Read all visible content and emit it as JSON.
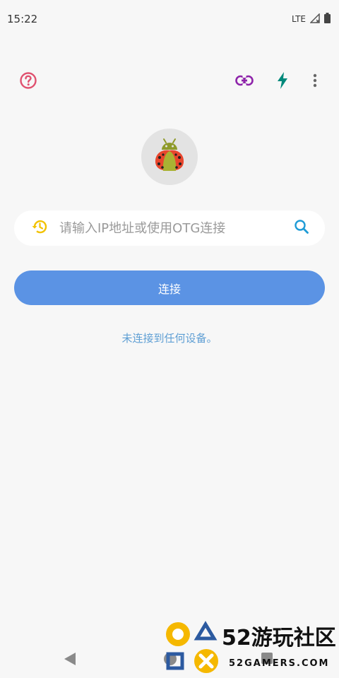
{
  "status_bar": {
    "time": "15:22",
    "network": "LTE"
  },
  "toolbar": {
    "icons": [
      "help-icon",
      "link-icon",
      "flash-icon",
      "more-vert-icon"
    ],
    "colors": {
      "help": "#e0516f",
      "link": "#8e24aa",
      "flash": "#00897b",
      "more": "#666666"
    }
  },
  "main": {
    "search_placeholder": "请输入IP地址或使用OTG连接",
    "search_value": "",
    "connect_label": "连接",
    "status_message": "未连接到任何设备。"
  },
  "watermark": {
    "title": "52游玩社区",
    "subtitle": "52GAMERS.COM"
  },
  "colors": {
    "accent": "#5b93e4",
    "status_text": "#5f9fd4",
    "history_icon": "#f2c200",
    "search_icon": "#1e9bd6"
  }
}
